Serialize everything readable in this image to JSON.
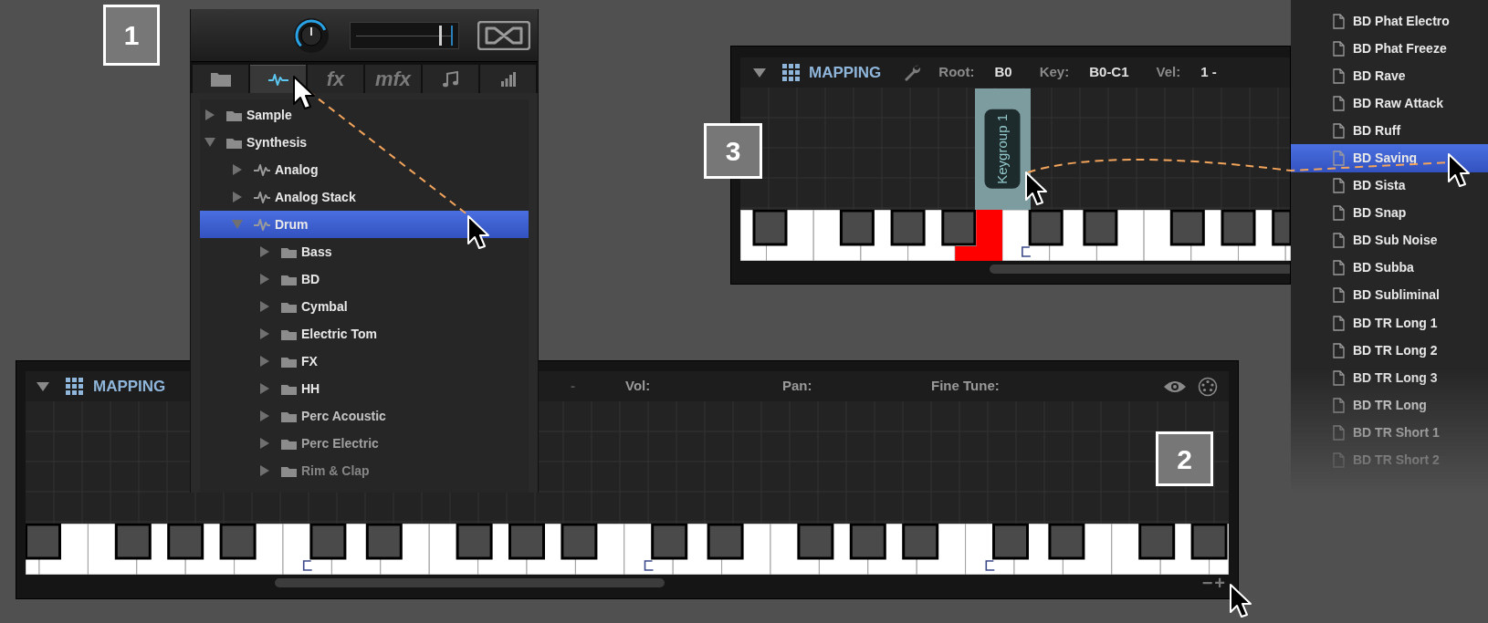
{
  "callouts": [
    {
      "number": "1"
    },
    {
      "number": "3"
    },
    {
      "number": "2"
    }
  ],
  "browser": {
    "volume_slider": {
      "level": 0.82
    },
    "tabs": [
      {
        "kind": "folder",
        "selected": false
      },
      {
        "kind": "wave",
        "selected": true
      },
      {
        "kind": "text",
        "label": "fx",
        "selected": false
      },
      {
        "kind": "text",
        "label": "mfx",
        "selected": false
      },
      {
        "kind": "note",
        "selected": false
      },
      {
        "kind": "bars",
        "selected": false
      }
    ],
    "tree": [
      {
        "label": "Sample",
        "kind": "folder",
        "expanded": false,
        "selected": false
      },
      {
        "label": "Synthesis",
        "kind": "folder",
        "expanded": true,
        "selected": false,
        "children": [
          {
            "label": "Analog",
            "kind": "wave",
            "expanded": false,
            "selected": false
          },
          {
            "label": "Analog Stack",
            "kind": "wave",
            "expanded": false,
            "selected": false
          },
          {
            "label": "Drum",
            "kind": "wave",
            "expanded": true,
            "selected": true,
            "children": [
              {
                "label": "Bass",
                "kind": "folder",
                "expanded": false,
                "selected": false
              },
              {
                "label": "BD",
                "kind": "folder",
                "expanded": false,
                "selected": false
              },
              {
                "label": "Cymbal",
                "kind": "folder",
                "expanded": false,
                "selected": false
              },
              {
                "label": "Electric Tom",
                "kind": "folder",
                "expanded": false,
                "selected": false
              },
              {
                "label": "FX",
                "kind": "folder",
                "expanded": false,
                "selected": false
              },
              {
                "label": "HH",
                "kind": "folder",
                "expanded": false,
                "selected": false
              },
              {
                "label": "Perc Acoustic",
                "kind": "folder",
                "expanded": false,
                "selected": false
              },
              {
                "label": "Perc Electric",
                "kind": "folder",
                "expanded": false,
                "selected": false
              },
              {
                "label": "Rim & Clap",
                "kind": "folder",
                "expanded": false,
                "selected": false
              }
            ]
          }
        ]
      }
    ]
  },
  "mapping_top": {
    "title": "MAPPING",
    "fields": [
      {
        "label": "Root:",
        "value": "B0"
      },
      {
        "label": "Key:",
        "value": "B0-C1"
      },
      {
        "label": "Vel:",
        "value": "1 -"
      }
    ],
    "keygroup": {
      "label": "Keygroup 1"
    },
    "root_key_highlighted": true
  },
  "preset_list": [
    {
      "label": "BD Phat Electro",
      "selected": false
    },
    {
      "label": "BD Phat Freeze",
      "selected": false
    },
    {
      "label": "BD Rave",
      "selected": false
    },
    {
      "label": "BD Raw Attack",
      "selected": false
    },
    {
      "label": "BD Ruff",
      "selected": false
    },
    {
      "label": "BD Saving",
      "selected": true
    },
    {
      "label": "BD Sista",
      "selected": false
    },
    {
      "label": "BD Snap",
      "selected": false
    },
    {
      "label": "BD Sub Noise",
      "selected": false
    },
    {
      "label": "BD Subba",
      "selected": false
    },
    {
      "label": "BD Subliminal",
      "selected": false
    },
    {
      "label": "BD TR Long 1",
      "selected": false
    },
    {
      "label": "BD TR Long 2",
      "selected": false
    },
    {
      "label": "BD TR Long 3",
      "selected": false
    },
    {
      "label": "BD TR Long",
      "selected": false
    },
    {
      "label": "BD TR Short 1",
      "selected": false
    },
    {
      "label": "BD TR Short 2",
      "selected": false
    }
  ],
  "mapping_bottom": {
    "title": "MAPPING",
    "fields": [
      {
        "label": "-"
      },
      {
        "label": "Vol:"
      },
      {
        "label": "Pan:"
      },
      {
        "label": "Fine Tune:"
      }
    ],
    "zoom_buttons": [
      "−",
      "+"
    ]
  }
}
